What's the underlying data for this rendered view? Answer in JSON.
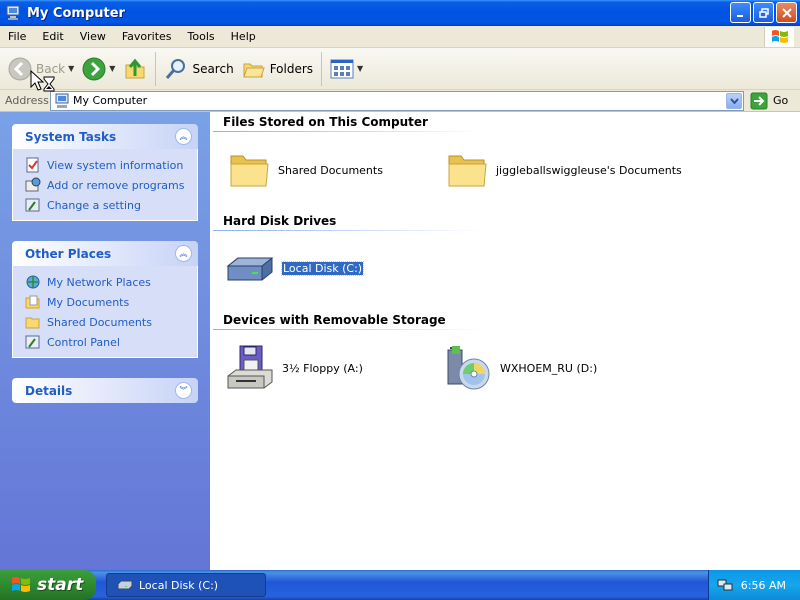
{
  "window": {
    "title": "My Computer"
  },
  "menu": [
    "File",
    "Edit",
    "View",
    "Favorites",
    "Tools",
    "Help"
  ],
  "toolbar": {
    "back": "Back",
    "search": "Search",
    "folders": "Folders"
  },
  "address": {
    "label": "Address",
    "value": "My Computer",
    "go": "Go"
  },
  "left_panel": {
    "system_tasks": {
      "title": "System Tasks",
      "items": [
        "View system information",
        "Add or remove programs",
        "Change a setting"
      ]
    },
    "other_places": {
      "title": "Other Places",
      "items": [
        "My Network Places",
        "My Documents",
        "Shared Documents",
        "Control Panel"
      ]
    },
    "details": {
      "title": "Details"
    }
  },
  "content": {
    "groups": [
      {
        "title": "Files Stored on This Computer",
        "items": [
          "Shared Documents",
          "jiggleballswiggleuse's Documents"
        ]
      },
      {
        "title": "Hard Disk Drives",
        "items": [
          "Local Disk (C:)"
        ]
      },
      {
        "title": "Devices with Removable Storage",
        "items": [
          "3½ Floppy (A:)",
          "WXHOEM_RU (D:)"
        ]
      }
    ]
  },
  "taskbar": {
    "start": "start",
    "window": "Local Disk (C:)",
    "clock": "6:56 AM"
  }
}
